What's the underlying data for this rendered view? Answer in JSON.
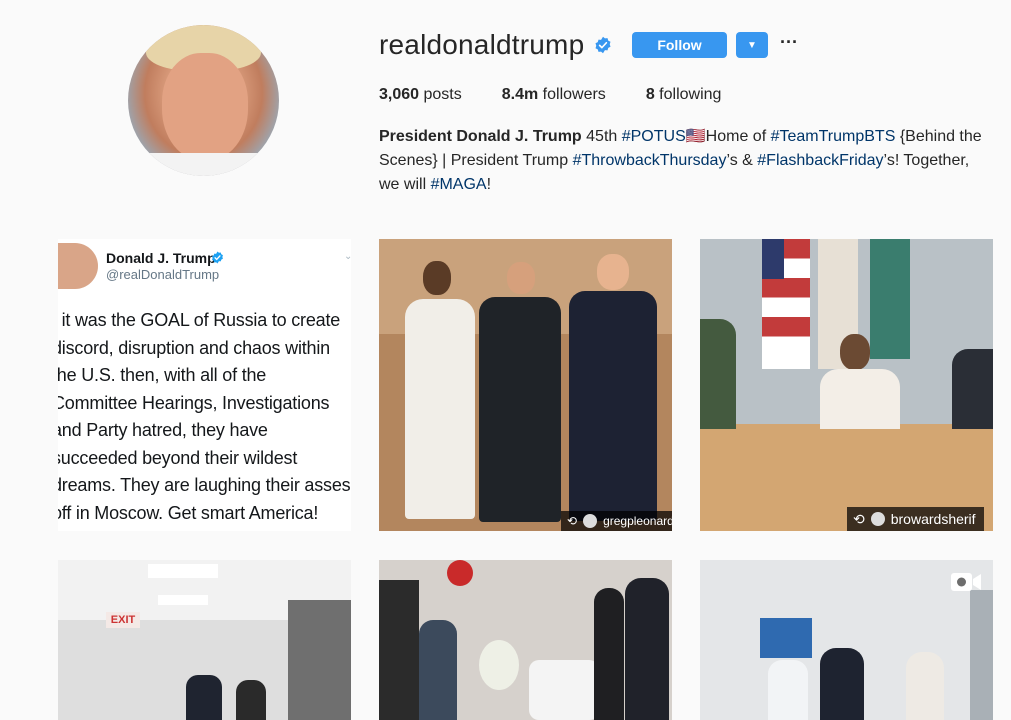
{
  "profile": {
    "username": "realdonaldtrump",
    "follow_label": "Follow",
    "more_label": "···",
    "stats": {
      "posts_count": "3,060",
      "posts_label": "posts",
      "followers_count": "8.4m",
      "followers_label": "followers",
      "following_count": "8",
      "following_label": "following"
    },
    "bio": {
      "name": "President Donald J. Trump",
      "part1": " 45th ",
      "tag_potus": "#POTUS",
      "flag": "🇺🇸",
      "part2": "Home of ",
      "tag_team": "#TeamTrumpBTS",
      "part3": " {Behind the Scenes} | President Trump ",
      "tag_throwback": "#ThrowbackThursday",
      "part4": "’s & ",
      "tag_flashback": "#FlashbackFriday",
      "part5": "’s! Together, we will ",
      "tag_maga": "#MAGA",
      "part6": "!"
    }
  },
  "posts": [
    {
      "type": "tweet",
      "tweet_name": "Donald J. Trump",
      "tweet_handle": "@realDonaldTrump",
      "tweet_text": "f it was the GOAL of Russia to create\ndiscord, disruption and chaos within\nthe U.S. then, with all of the\nCommittee Hearings, Investigations\nand Party hatred, they have\nsucceeded beyond their wildest\ndreams. They are laughing their asses\noff in Moscow. Get smart America!"
    },
    {
      "type": "photo",
      "repost_user": "gregpleonard"
    },
    {
      "type": "photo",
      "repost_user": "browardsherif"
    },
    {
      "type": "photo",
      "sign_text": "EXIT"
    },
    {
      "type": "photo"
    },
    {
      "type": "video"
    }
  ],
  "colors": {
    "accent": "#3897f0",
    "hashtag": "#003569",
    "verified": "#3897f0"
  }
}
